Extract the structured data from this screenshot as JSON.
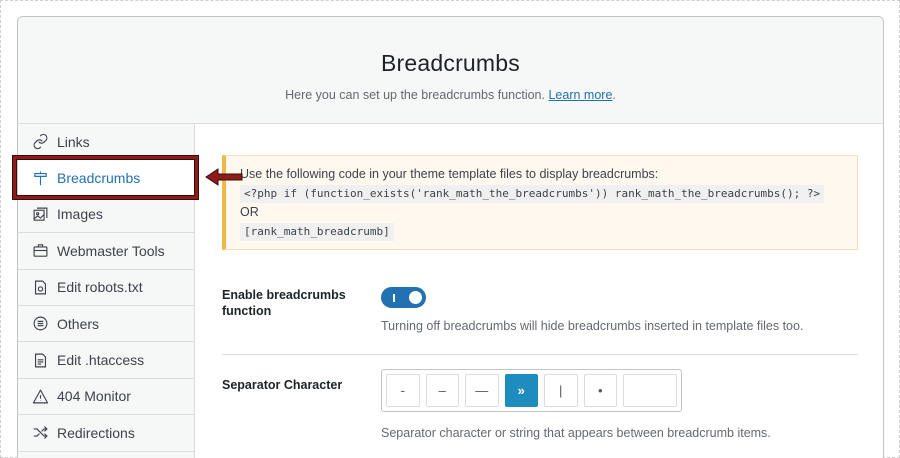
{
  "header": {
    "title": "Breadcrumbs",
    "subtitle": "Here you can set up the breadcrumbs function.",
    "learn_more": "Learn more",
    "subtitle_end": "."
  },
  "sidebar": {
    "items": [
      {
        "label": "Links",
        "icon": "link-icon"
      },
      {
        "label": "Breadcrumbs",
        "icon": "signpost-icon",
        "active": true
      },
      {
        "label": "Images",
        "icon": "images-icon"
      },
      {
        "label": "Webmaster Tools",
        "icon": "briefcase-icon"
      },
      {
        "label": "Edit robots.txt",
        "icon": "robot-file-icon"
      },
      {
        "label": "Others",
        "icon": "list-circle-icon"
      },
      {
        "label": "Edit .htaccess",
        "icon": "document-icon"
      },
      {
        "label": "404 Monitor",
        "icon": "warning-icon"
      },
      {
        "label": "Redirections",
        "icon": "shuffle-icon"
      }
    ]
  },
  "notice": {
    "line1": "Use the following code in your theme template files to display breadcrumbs:",
    "code1": "<?php if (function_exists('rank_math_the_breadcrumbs')) rank_math_the_breadcrumbs(); ?>",
    "or": "OR",
    "code2": "[rank_math_breadcrumb]"
  },
  "enable": {
    "label": "Enable breadcrumbs function",
    "enabled": true,
    "description": "Turning off breadcrumbs will hide breadcrumbs inserted in template files too."
  },
  "separator": {
    "label": "Separator Character",
    "options": [
      "-",
      "–",
      "—",
      "»",
      "|",
      "•"
    ],
    "selected": "»",
    "custom_value": "",
    "description": "Separator character or string that appears between breadcrumb items."
  },
  "colors": {
    "accent": "#2271b1",
    "active_separator": "#1e8cbe",
    "highlight_border": "#8e1b1b",
    "notice_border": "#f0b849"
  }
}
